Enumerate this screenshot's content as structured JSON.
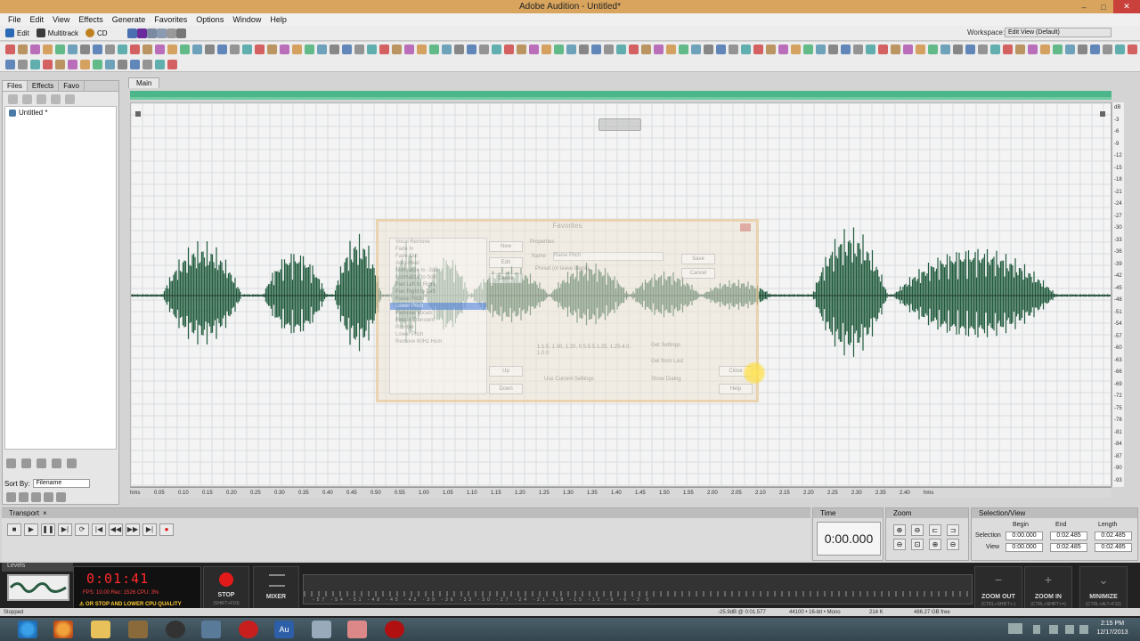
{
  "window": {
    "title": "Adobe Audition - Untitled*"
  },
  "menu": [
    "File",
    "Edit",
    "View",
    "Effects",
    "Generate",
    "Favorites",
    "Options",
    "Window",
    "Help"
  ],
  "view_modes": [
    {
      "label": "Edit",
      "color": "#2a6ab4"
    },
    {
      "label": "Multitrack",
      "color": "#3a3a3a"
    },
    {
      "label": "CD",
      "color": "#c08020"
    }
  ],
  "workspace": {
    "label": "Workspace:",
    "value": "Edit View (Default)"
  },
  "left_panel": {
    "tabs": [
      "Files",
      "Effects",
      "Favo"
    ],
    "files": [
      {
        "name": "Untitled *"
      }
    ],
    "sort_label": "Sort By:",
    "sort_value": "Filename"
  },
  "editor": {
    "tab": "Main",
    "overview_color": "#4db58a",
    "wave_color": "#1f5a3c"
  },
  "amplitude_scale": [
    "dB",
    "-3",
    "-6",
    "-9",
    "-12",
    "-15",
    "-18",
    "-21",
    "-24",
    "-27",
    "-30",
    "-33",
    "-36",
    "-39",
    "-42",
    "-45",
    "-48",
    "-51",
    "-54",
    "-57",
    "-60",
    "-63",
    "-66",
    "-69",
    "-72",
    "-75",
    "-78",
    "-81",
    "-84",
    "-87",
    "-90",
    "-93"
  ],
  "timeline_labels": [
    "hms",
    "0.05",
    "0.10",
    "0.15",
    "0.20",
    "0.25",
    "0.30",
    "0.35",
    "0.40",
    "0.45",
    "0.50",
    "0.55",
    "1.00",
    "1.05",
    "1.10",
    "1.15",
    "1.20",
    "1.25",
    "1.30",
    "1.35",
    "1.40",
    "1.45",
    "1.50",
    "1.55",
    "2.00",
    "2.05",
    "2.10",
    "2.15",
    "2.20",
    "2.25",
    "2.30",
    "2.35",
    "2.40",
    "hms"
  ],
  "favorites_dialog": {
    "title": "Favorites",
    "list": [
      "Vocal Remove",
      "Fade In",
      "Fade Out",
      "Auto-Heal",
      "Normalize to -3dB",
      "Normalize to 0dB",
      "Pan Left to Right",
      "Pan Right to Left",
      "Raise Pitch",
      "Lower Pitch",
      "Remove Vocals",
      "Repair Transient",
      "Rumble",
      "Lower Pitch",
      "Remove 60Hz Hum"
    ],
    "selected_index": 9,
    "buttons": {
      "new": "New",
      "edit": "Edit",
      "delete": "Delete",
      "up": "Up",
      "down": "Down",
      "close": "Close",
      "help": "Help",
      "save": "Save",
      "cancel": "Cancel"
    },
    "properties_label": "Properties",
    "name_label": "Name",
    "name_value": "Raise Pitch",
    "preset_label": "Preset (or leave blank)",
    "ratio_text": "1.1.5, 1.30, 1.20, 0.5.5.5.1.25, 1.25.4.0, 1.0.0",
    "current_settings": "Use Current Settings",
    "show_dialog": "Show Dialog",
    "get_settings": "Get Settings",
    "from_range": "Get from Last"
  },
  "transport": {
    "title": "Transport",
    "buttons": [
      "■",
      "▶",
      "❚❚",
      "▶|",
      "⟳",
      "|◀",
      "◀◀",
      "▶▶",
      "▶|",
      "●"
    ]
  },
  "time": {
    "title": "Time",
    "value": "0:00.000"
  },
  "zoom": {
    "title": "Zoom"
  },
  "selection_view": {
    "title": "Selection/View",
    "headers": [
      "Begin",
      "End",
      "Length"
    ],
    "rows": [
      {
        "label": "Selection",
        "begin": "0:00.000",
        "end": "0:02.485",
        "length": "0:02.485"
      },
      {
        "label": "View",
        "begin": "0:00.000",
        "end": "0:02.485",
        "length": "0:02.485"
      }
    ]
  },
  "levels": {
    "title": "Levels",
    "scale": "-57 -54 -51 -48 -45 -42 -39 -36 -33 -30 -27 -24 -21 -18 -15 -12 -9 -6 -3 0"
  },
  "recorder": {
    "time": "0:01:41",
    "stats": "FPS: 10.00   Rec: 1526   CPU: 3%",
    "warning": "OR STOP AND LOWER CPU QUALITY"
  },
  "stop": {
    "label": "STOP",
    "shortcut": "(SHIFT+F10)"
  },
  "mixer": {
    "label": "MIXER"
  },
  "zoom_out": {
    "label": "ZOOM OUT",
    "shortcut": "(CTRL+SHIFT+-)"
  },
  "zoom_in": {
    "label": "ZOOM IN",
    "shortcut": "(CTRL+SHIFT+=)"
  },
  "minimize": {
    "label": "MINIMIZE",
    "shortcut": "(CTRL+ALT+F10)"
  },
  "status_bar": {
    "left": "Stopped",
    "db": "-25.9dB @ 0:01.577",
    "format": "44100 • 16-bit • Mono",
    "size": "214 K",
    "free": "486.27 GB free"
  },
  "clock": {
    "time": "2:15 PM",
    "date": "12/17/2013"
  }
}
